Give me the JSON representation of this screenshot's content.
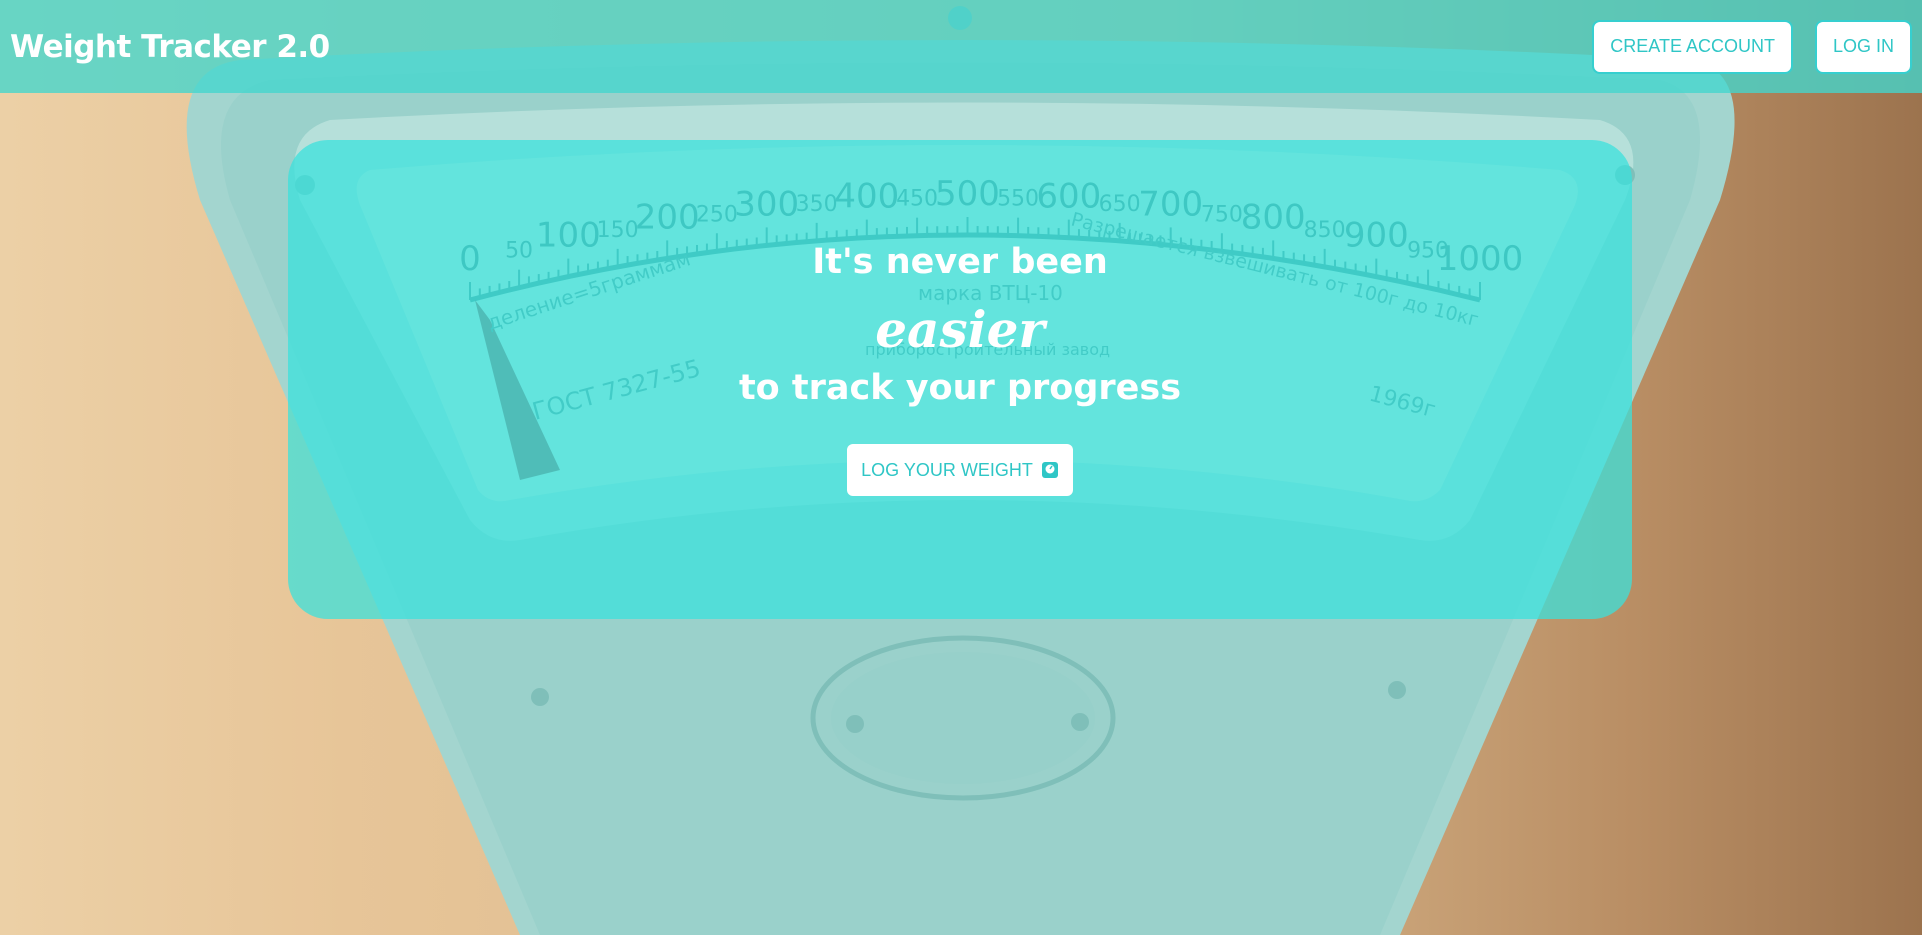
{
  "app": {
    "brand": "Weight Tracker 2.0"
  },
  "nav": {
    "create_account": "CREATE ACCOUNT",
    "log_in": "LOG IN"
  },
  "hero": {
    "line1": "It's never been",
    "accent": "easier",
    "line3": "to track your progress",
    "cta_label": "LOG YOUR WEIGHT",
    "cta_icon": "scale-icon"
  },
  "background": {
    "scale_labels": [
      "0",
      "50",
      "100",
      "150",
      "200",
      "250",
      "300",
      "350",
      "400",
      "450",
      "500",
      "550",
      "600",
      "650",
      "700",
      "750",
      "800",
      "850",
      "900",
      "950",
      "1000"
    ],
    "scale_caption_left": "деление=5граммам",
    "scale_caption_right": "Разрешается взвешивать от 100г до 10кг",
    "model_label": "марка ВТЦ-10",
    "factory_text": "приборостроительный завод",
    "standard_text": "ГОСТ 7327-55",
    "year_text": "1969г"
  },
  "colors": {
    "accent": "#2fc6c6",
    "nav_overlay": "#43d6cd",
    "hero_overlay": "#3ae1dc",
    "scale_body": "#8fd0cb"
  }
}
